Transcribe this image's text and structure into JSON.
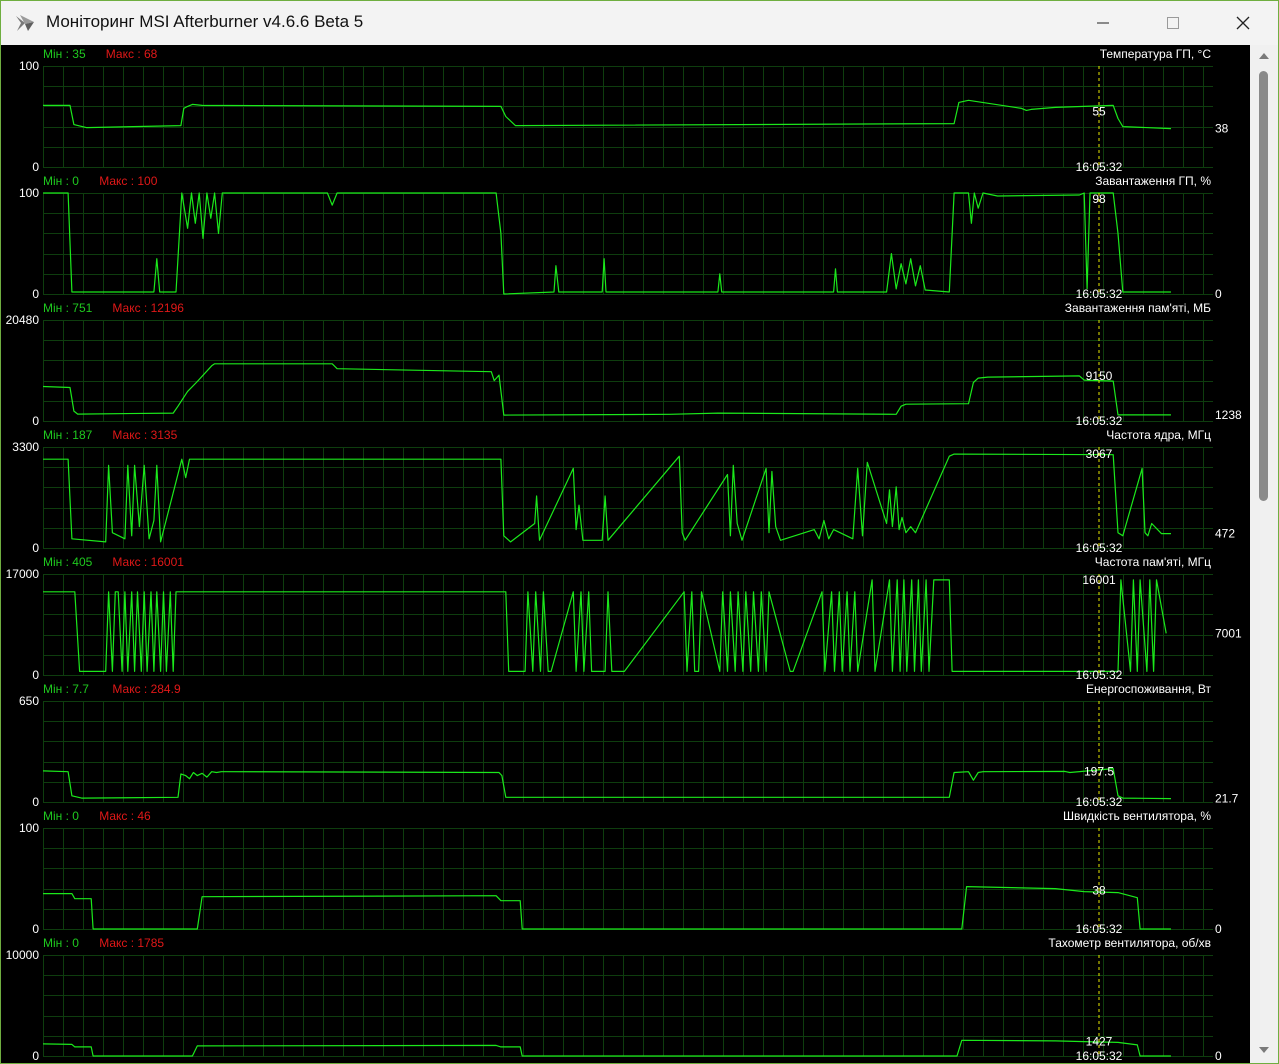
{
  "window": {
    "title": "Моніторинг MSI Afterburner v4.6.6 Beta 5",
    "border_color": "#6fae40"
  },
  "labels": {
    "min_prefix": "Мін : ",
    "max_prefix": "Макс : ",
    "cursor_time": "16:05:32"
  },
  "colors": {
    "line": "#1be81b",
    "grid": "#0e3d0e",
    "min_text": "#1fc91f",
    "max_text": "#e01818",
    "text": "#ffffff",
    "cursor": "#e8e800",
    "background": "#000000"
  },
  "icons": {
    "app": "afterburner-plane-icon",
    "minimize": "minimize-icon",
    "maximize": "maximize-icon",
    "close": "close-icon",
    "scroll_up": "scroll-up-icon",
    "scroll_down": "scroll-down-icon"
  },
  "chart_data": [
    {
      "type": "line",
      "title": "Температура ГП, °C",
      "min": "35",
      "max": "68",
      "ylim": [
        0,
        100
      ],
      "y_top_label": "100",
      "y_bottom_label": "0",
      "cursor_value": "55",
      "current_value": "38",
      "x": [
        0,
        28,
        32,
        45,
        143,
        146,
        150,
        155,
        165,
        475,
        480,
        490,
        945,
        950,
        960,
        1015,
        1020,
        1025,
        1050,
        1110,
        1115,
        1120,
        1170
      ],
      "y": [
        61,
        61,
        42,
        39,
        41,
        58,
        60,
        62,
        61,
        60,
        50,
        41,
        43,
        64,
        66,
        58,
        56,
        57,
        59,
        61,
        48,
        40,
        38
      ]
    },
    {
      "type": "line",
      "title": "Завантаження ГП, %",
      "min": "0",
      "max": "100",
      "ylim": [
        0,
        100
      ],
      "y_top_label": "100",
      "y_bottom_label": "0",
      "cursor_value": "98",
      "current_value": "0",
      "x": [
        0,
        26,
        30,
        115,
        118,
        121,
        138,
        144,
        150,
        154,
        158,
        162,
        166,
        170,
        174,
        178,
        182,
        186,
        190,
        195,
        220,
        295,
        300,
        305,
        470,
        475,
        478,
        530,
        532,
        535,
        580,
        582,
        584,
        700,
        702,
        704,
        820,
        822,
        824,
        875,
        880,
        885,
        890,
        895,
        900,
        905,
        910,
        915,
        940,
        945,
        960,
        963,
        966,
        970,
        975,
        990,
        1075,
        1080,
        1083,
        1086,
        1110,
        1115,
        1120,
        1170
      ],
      "y": [
        100,
        100,
        2,
        2,
        35,
        2,
        2,
        100,
        65,
        100,
        70,
        100,
        55,
        100,
        75,
        100,
        60,
        100,
        100,
        100,
        100,
        100,
        88,
        100,
        100,
        60,
        0,
        2,
        28,
        2,
        2,
        35,
        2,
        2,
        20,
        2,
        2,
        25,
        2,
        2,
        40,
        5,
        30,
        10,
        35,
        8,
        28,
        4,
        2,
        100,
        100,
        70,
        100,
        85,
        100,
        97,
        98,
        100,
        5,
        100,
        100,
        60,
        2,
        2
      ]
    },
    {
      "type": "line",
      "title": "Завантаження пам'яті, МБ",
      "min": "751",
      "max": "12196",
      "ylim": [
        0,
        20480
      ],
      "y_top_label": "20480",
      "y_bottom_label": "0",
      "cursor_value": "9150",
      "current_value": "1238",
      "x": [
        0,
        28,
        32,
        36,
        135,
        140,
        145,
        150,
        160,
        175,
        178,
        182,
        300,
        305,
        465,
        468,
        473,
        478,
        650,
        700,
        885,
        890,
        895,
        960,
        965,
        970,
        980,
        1075,
        1080,
        1110,
        1115,
        1170
      ],
      "y": [
        7000,
        6800,
        2000,
        1400,
        1600,
        3000,
        4500,
        6000,
        8000,
        11200,
        11600,
        11600,
        11600,
        10600,
        10000,
        8200,
        9300,
        1200,
        1350,
        1600,
        1350,
        3000,
        3400,
        3500,
        7800,
        8700,
        8900,
        9150,
        8300,
        8100,
        1238,
        1238
      ]
    },
    {
      "type": "line",
      "title": "Частота ядра, МГц",
      "min": "187",
      "max": "3135",
      "ylim": [
        0,
        3300
      ],
      "y_top_label": "3300",
      "y_bottom_label": "0",
      "cursor_value": "3067",
      "current_value": "472",
      "x": [
        0,
        26,
        30,
        65,
        68,
        72,
        85,
        88,
        92,
        95,
        100,
        105,
        110,
        115,
        118,
        122,
        144,
        148,
        152,
        156,
        160,
        475,
        478,
        485,
        510,
        512,
        515,
        550,
        553,
        556,
        560,
        580,
        583,
        586,
        660,
        663,
        666,
        710,
        713,
        716,
        720,
        725,
        750,
        753,
        756,
        760,
        765,
        800,
        805,
        810,
        815,
        820,
        840,
        845,
        850,
        855,
        875,
        878,
        881,
        885,
        888,
        891,
        895,
        900,
        905,
        940,
        945,
        1110,
        1115,
        1120,
        1140,
        1143,
        1146,
        1150,
        1160,
        1170
      ],
      "y": [
        2900,
        2900,
        300,
        200,
        2700,
        500,
        300,
        2700,
        400,
        2700,
        700,
        2700,
        300,
        900,
        2700,
        200,
        2900,
        2300,
        2900,
        2900,
        2900,
        2900,
        400,
        200,
        800,
        1700,
        250,
        2600,
        600,
        1400,
        250,
        250,
        1700,
        250,
        3000,
        500,
        250,
        2400,
        400,
        2700,
        800,
        250,
        2600,
        500,
        2500,
        700,
        250,
        600,
        300,
        900,
        300,
        600,
        300,
        2600,
        400,
        2800,
        800,
        1900,
        700,
        2000,
        600,
        1000,
        500,
        700,
        500,
        3000,
        3067,
        3050,
        500,
        400,
        2600,
        500,
        400,
        800,
        472,
        472
      ]
    },
    {
      "type": "line",
      "title": "Частота пам'яті, МГц",
      "min": "405",
      "max": "16001",
      "ylim": [
        0,
        17000
      ],
      "y_top_label": "17000",
      "y_bottom_label": "0",
      "cursor_value": "16001",
      "current_value": "7001",
      "x": [
        0,
        33,
        38,
        65,
        68,
        72,
        75,
        78,
        82,
        85,
        88,
        92,
        95,
        98,
        102,
        105,
        108,
        112,
        115,
        118,
        122,
        125,
        128,
        132,
        135,
        138,
        142,
        480,
        483,
        500,
        503,
        508,
        511,
        516,
        519,
        524,
        527,
        550,
        553,
        558,
        561,
        566,
        569,
        583,
        586,
        590,
        593,
        600,
        603,
        665,
        668,
        673,
        676,
        680,
        683,
        702,
        705,
        710,
        713,
        718,
        721,
        726,
        729,
        734,
        737,
        742,
        745,
        750,
        753,
        775,
        778,
        808,
        811,
        818,
        821,
        826,
        829,
        834,
        837,
        842,
        845,
        860,
        863,
        878,
        881,
        886,
        889,
        893,
        896,
        901,
        904,
        908,
        911,
        916,
        919,
        924,
        927,
        940,
        943,
        1115,
        1118,
        1128,
        1131,
        1135,
        1138,
        1145,
        1148,
        1152,
        1155,
        1165,
        1170
      ],
      "y": [
        14000,
        14000,
        600,
        600,
        14000,
        600,
        14000,
        14000,
        600,
        14000,
        600,
        14000,
        600,
        14000,
        600,
        14000,
        600,
        14000,
        600,
        14000,
        600,
        14000,
        600,
        14000,
        600,
        14000,
        14000,
        14000,
        600,
        600,
        14000,
        600,
        14000,
        600,
        14000,
        600,
        600,
        14000,
        600,
        14000,
        600,
        14000,
        600,
        600,
        14000,
        600,
        600,
        600,
        600,
        14000,
        600,
        14000,
        600,
        600,
        14000,
        600,
        14000,
        600,
        14000,
        600,
        14000,
        600,
        14000,
        600,
        14000,
        600,
        14000,
        600,
        14000,
        600,
        600,
        14000,
        600,
        14000,
        600,
        14000,
        600,
        14000,
        600,
        14000,
        600,
        16000,
        600,
        16000,
        600,
        16000,
        600,
        16000,
        600,
        16000,
        600,
        16000,
        600,
        16000,
        600,
        16000,
        16001,
        16001,
        600,
        600,
        16000,
        600,
        16000,
        600,
        16000,
        600,
        16000,
        600,
        16000,
        7001
      ]
    },
    {
      "type": "line",
      "title": "Енергоспоживання, Вт",
      "min": "7.7",
      "max": "284.9",
      "ylim": [
        0,
        650
      ],
      "y_top_label": "650",
      "y_bottom_label": "0",
      "cursor_value": "197.5",
      "current_value": "21.7",
      "x": [
        0,
        26,
        30,
        40,
        140,
        143,
        148,
        152,
        156,
        160,
        165,
        170,
        175,
        180,
        185,
        190,
        473,
        476,
        480,
        940,
        945,
        960,
        965,
        970,
        975,
        1060,
        1065,
        1110,
        1115,
        1120,
        1170
      ],
      "y": [
        200,
        195,
        40,
        25,
        30,
        180,
        170,
        150,
        190,
        170,
        185,
        160,
        195,
        190,
        195,
        195,
        190,
        170,
        30,
        30,
        190,
        195,
        140,
        190,
        195,
        197,
        190,
        215,
        40,
        25,
        21.7
      ]
    },
    {
      "type": "line",
      "title": "Швидкість вентилятора, %",
      "min": "0",
      "max": "46",
      "ylim": [
        0,
        100
      ],
      "y_top_label": "100",
      "y_bottom_label": "0",
      "cursor_value": "38",
      "current_value": "0",
      "x": [
        0,
        30,
        33,
        50,
        52,
        160,
        165,
        470,
        475,
        495,
        497,
        953,
        958,
        1050,
        1080,
        1115,
        1135,
        1138,
        1170
      ],
      "y": [
        35,
        35,
        30,
        30,
        0,
        0,
        32,
        33,
        28,
        28,
        0,
        0,
        42,
        40,
        37,
        36,
        31,
        0,
        0
      ]
    },
    {
      "type": "line",
      "title": "Тахометр вентилятора, об/хв",
      "min": "0",
      "max": "1785",
      "ylim": [
        0,
        10000
      ],
      "y_top_label": "10000",
      "y_bottom_label": "0",
      "cursor_value": "1427",
      "current_value": "0",
      "x": [
        0,
        30,
        33,
        50,
        52,
        155,
        160,
        470,
        475,
        495,
        497,
        948,
        953,
        1050,
        1080,
        1115,
        1135,
        1138,
        1170
      ],
      "y": [
        1200,
        1150,
        900,
        900,
        0,
        0,
        1000,
        1050,
        900,
        900,
        0,
        0,
        1550,
        1500,
        1427,
        1350,
        1100,
        0,
        0
      ]
    }
  ]
}
